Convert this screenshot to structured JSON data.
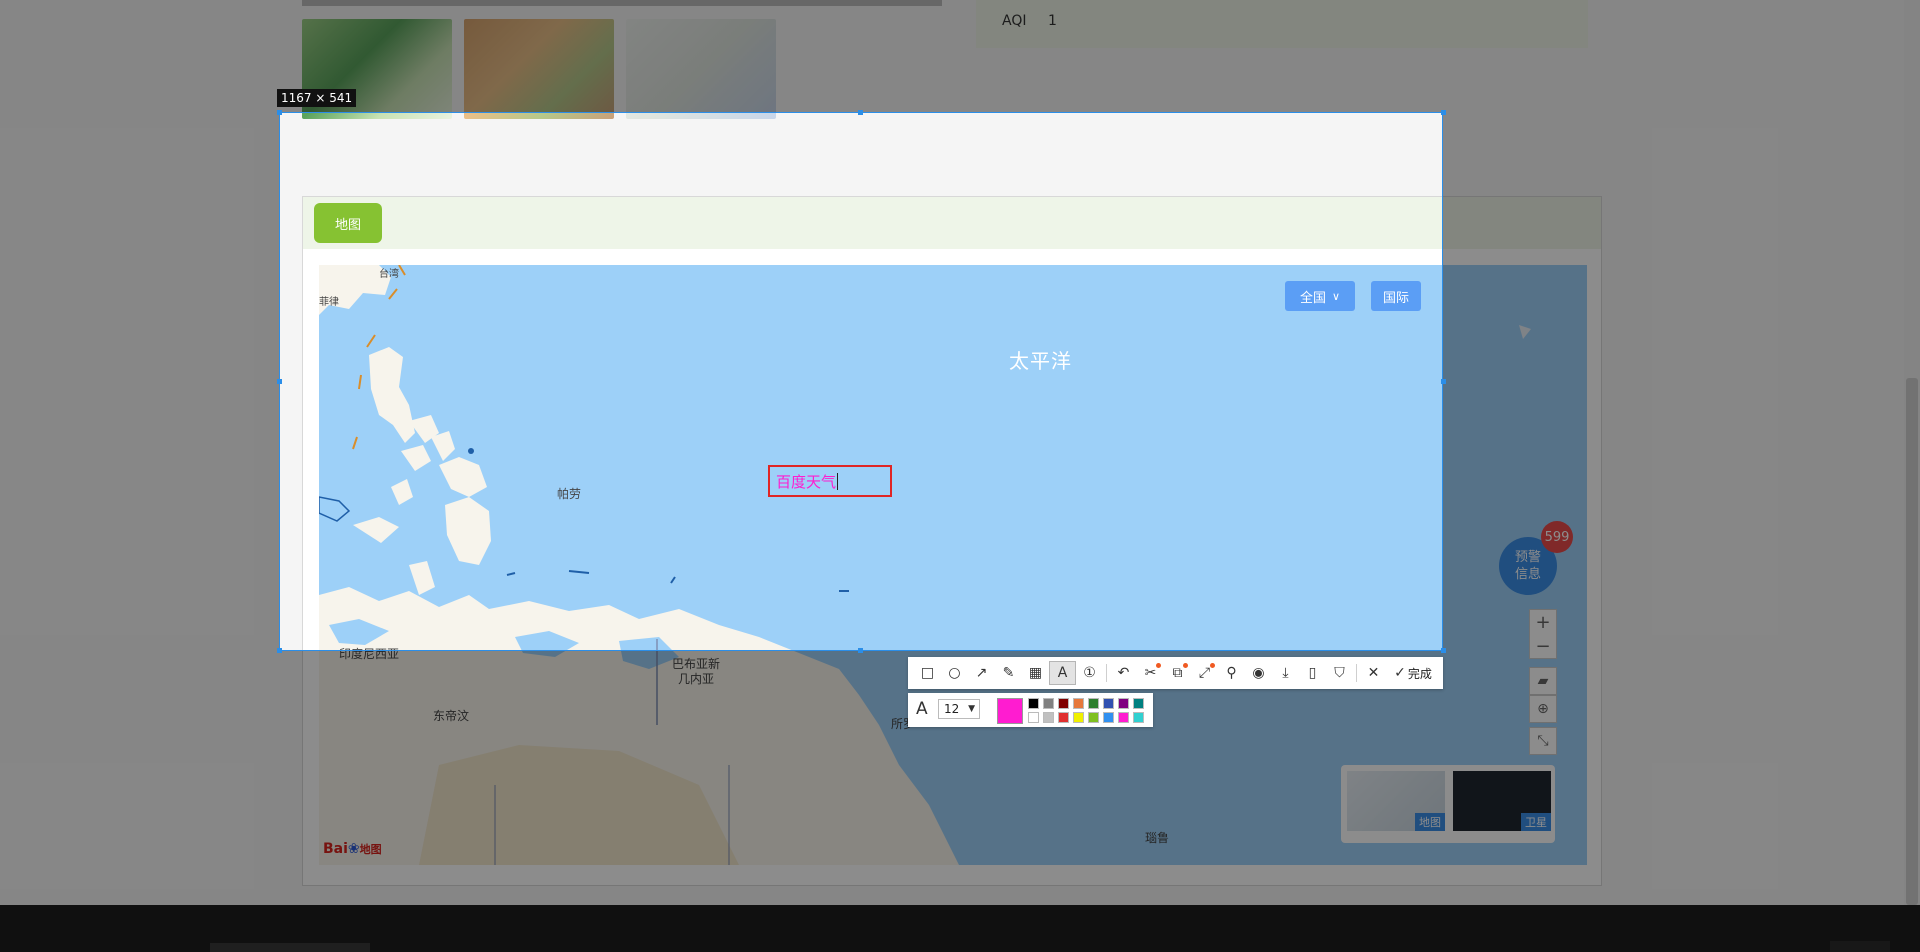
{
  "background_page": {
    "aqi_label": "AQI",
    "aqi_value": "1",
    "map_tab_label": "地图",
    "map": {
      "region_select_label": "全国",
      "international_label": "国际",
      "ocean_label": "太平洋",
      "place_labels": {
        "taiwan": "台湾",
        "small_tl": "菲律",
        "palau": "帕劳",
        "indonesia": "印度尼西亚",
        "png": "巴布亚新几内亚",
        "dongnan": "东帝汶",
        "mid": "所罗",
        "bottom": "瑙鲁"
      },
      "warning": {
        "line1": "预警",
        "line2": "信息",
        "count": "599"
      },
      "zoom_in": "+",
      "zoom_out": "−",
      "layer_map_label": "地图",
      "layer_satellite_label": "卫星",
      "baidu_logo": "Bai",
      "baidu_logo_suffix": "地图"
    }
  },
  "capture": {
    "size_label": "1167 × 541",
    "text_annotation": "百度天气",
    "font_size": "12",
    "current_color": "#ff1cd0",
    "done_label": "完成",
    "palette_top": [
      "#000000",
      "#808080",
      "#800000",
      "#e6783c",
      "#2f7f2f",
      "#3050b0",
      "#800080",
      "#008080"
    ],
    "palette_bottom": [
      "#ffffff",
      "#c0c0c0",
      "#e03030",
      "#f0f000",
      "#80c020",
      "#3090f0",
      "#ff1cd0",
      "#30d0d0"
    ],
    "tools": [
      {
        "name": "rectangle-tool",
        "glyph": "□"
      },
      {
        "name": "ellipse-tool",
        "glyph": "○"
      },
      {
        "name": "arrow-tool",
        "glyph": "↗"
      },
      {
        "name": "pencil-tool",
        "glyph": "✎"
      },
      {
        "name": "mosaic-tool",
        "glyph": "▦"
      },
      {
        "name": "text-tool",
        "glyph": "A"
      },
      {
        "name": "serial-number-tool",
        "glyph": "①"
      },
      {
        "name": "undo-tool",
        "glyph": "↶"
      },
      {
        "name": "scissors-tool",
        "glyph": "✂"
      },
      {
        "name": "ocr-tool",
        "glyph": "⧉"
      },
      {
        "name": "scroll-capture-tool",
        "glyph": "⤢"
      },
      {
        "name": "pin-tool",
        "glyph": "⚲"
      },
      {
        "name": "record-tool",
        "glyph": "◉"
      },
      {
        "name": "download-tool",
        "glyph": "⤓"
      },
      {
        "name": "phone-tool",
        "glyph": "▯"
      },
      {
        "name": "bookmark-tool",
        "glyph": "⛉"
      }
    ],
    "close_glyph": "✕",
    "done_glyph": "✓"
  }
}
